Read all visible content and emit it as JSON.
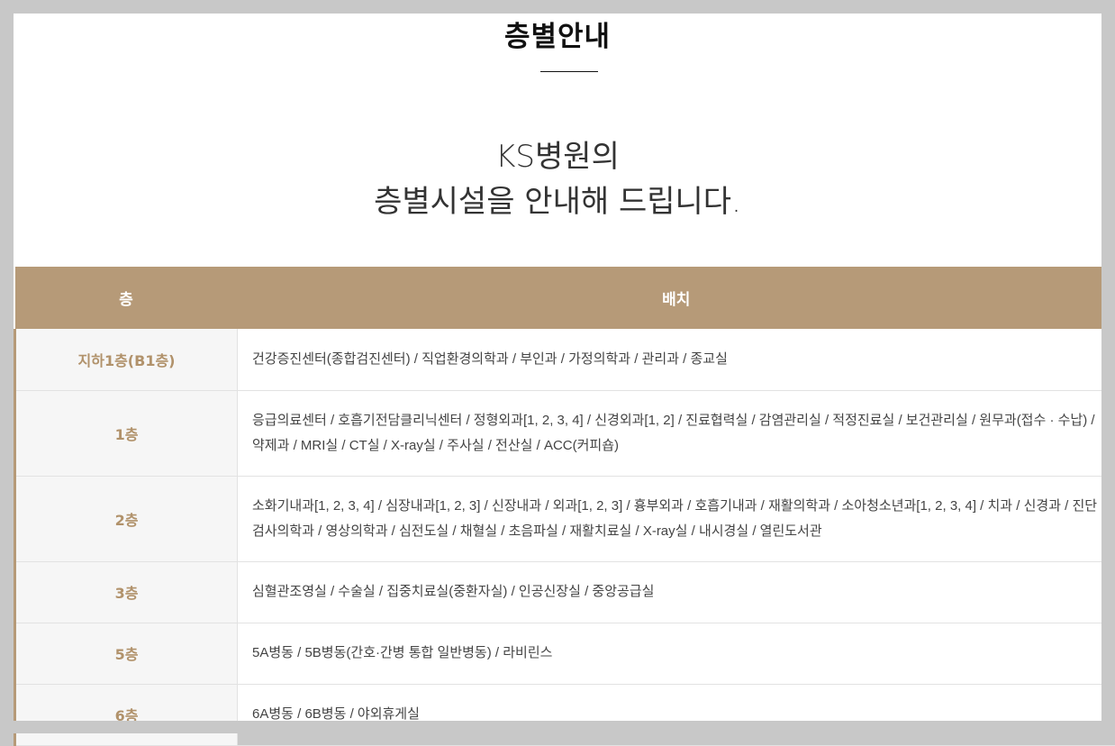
{
  "page": {
    "title": "층별안내",
    "intro_line1": "KS병원의",
    "intro_line2": "층별시설을 안내해 드립니다."
  },
  "table": {
    "headers": [
      "층",
      "배치"
    ],
    "rows": [
      {
        "floor": "지하1층(B1층)",
        "layout": "건강증진센터(종합검진센터) / 직업환경의학과 / 부인과 / 가정의학과 / 관리과 / 종교실"
      },
      {
        "floor": "1층",
        "layout": "응급의료센터 / 호흡기전담클리닉센터 / 정형외과[1, 2, 3, 4] / 신경외과[1, 2] / 진료협력실 / 감염관리실 / 적정진료실 / 보건관리실 / 원무과(접수 · 수납) / 약제과 / MRI실 / CT실 / X-ray실 / 주사실 / 전산실 / ACC(커피숍)"
      },
      {
        "floor": "2층",
        "layout": "소화기내과[1, 2, 3, 4] / 심장내과[1, 2, 3] / 신장내과 / 외과[1, 2, 3] / 흉부외과 / 호흡기내과 / 재활의학과 / 소아청소년과[1, 2, 3, 4] / 치과 / 신경과 / 진단검사의학과 / 영상의학과 / 심전도실 / 채혈실 / 초음파실 / 재활치료실 / X-ray실 / 내시경실 / 열린도서관"
      },
      {
        "floor": "3층",
        "layout": "심혈관조영실 / 수술실 / 집중치료실(중환자실) / 인공신장실 / 중앙공급실"
      },
      {
        "floor": "5층",
        "layout": "5A병동 / 5B병동(간호·간병 통합 일반병동) / 라비린스"
      },
      {
        "floor": "6층",
        "layout": "6A병동 / 6B병동 / 야외휴게실"
      }
    ]
  },
  "colors": {
    "accent": "#b69a78",
    "floor_text": "#b1926b",
    "frame": "#c8c8c8"
  }
}
